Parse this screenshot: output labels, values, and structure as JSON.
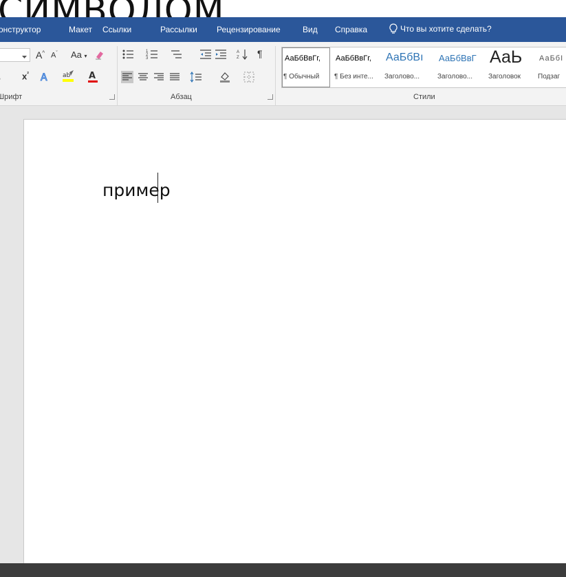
{
  "heading_text": "СИМВОЛОМ",
  "tabs": [
    "Конструктор",
    "Макет",
    "Ссылки",
    "Рассылки",
    "Рецензирование",
    "Вид",
    "Справка"
  ],
  "tell_me": {
    "label": "Что вы хотите сделать?",
    "icon": "lightbulb-icon"
  },
  "font_group": {
    "label": "Шрифт",
    "change_case_label": "Aa",
    "grow_font": "A",
    "shrink_font": "A"
  },
  "paragraph_group": {
    "label": "Абзац"
  },
  "styles_group": {
    "label": "Стили",
    "items": [
      {
        "preview": "АаБбВвГг,",
        "name": "¶ Обычный",
        "active": true
      },
      {
        "preview": "АаБбВвГг,",
        "name": "¶ Без инте..."
      },
      {
        "preview": "АаБбВı",
        "name": "Заголово..."
      },
      {
        "preview": "АаБбВвГ",
        "name": "Заголово..."
      },
      {
        "preview": "АаЬ",
        "name": "Заголовок"
      },
      {
        "preview": "АаБбI",
        "name": "Подзаг"
      }
    ]
  },
  "document": {
    "text": "пример"
  },
  "colors": {
    "ribbon_tab_bg": "#2b579a",
    "ribbon_bg": "#f3f3f3",
    "heading_style_blue": "#2e74b5",
    "highlight_yellow": "#ffff00",
    "font_color_red": "#e00000"
  }
}
